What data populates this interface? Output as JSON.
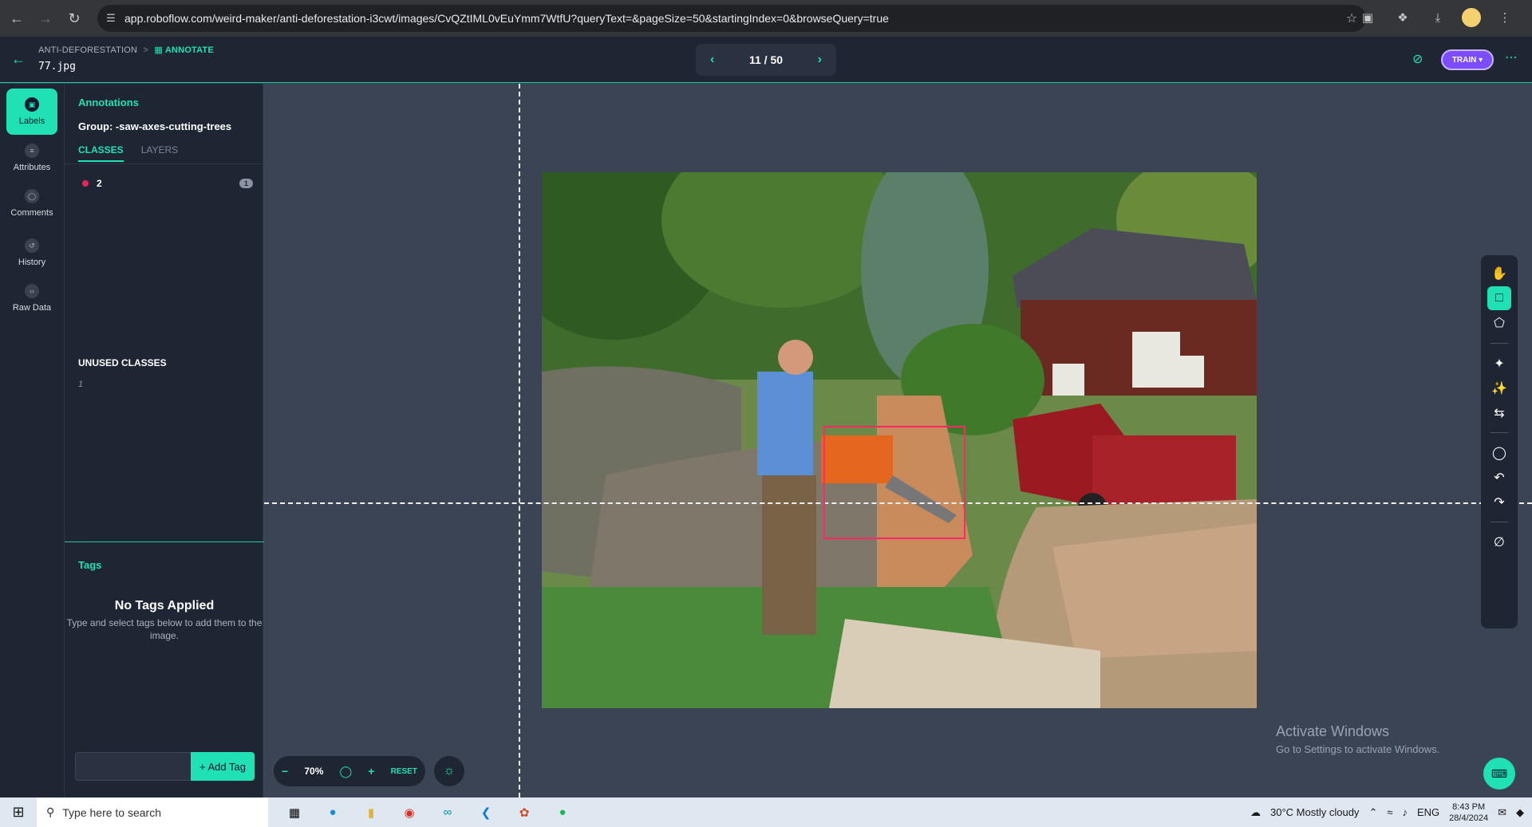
{
  "browser": {
    "url": "app.roboflow.com/weird-maker/anti-deforestation-i3cwt/images/CvQZtIML0vEuYmm7WtfU?queryText=&pageSize=50&startingIndex=0&browseQuery=true"
  },
  "header": {
    "breadcrumb_project": "ANTI-DEFORESTATION",
    "breadcrumb_separator": ">",
    "breadcrumb_current": "ANNOTATE",
    "filename": "77.jpg",
    "pager": "11 / 50",
    "train_label": "TRAIN"
  },
  "rail": {
    "items": [
      {
        "label": "Labels"
      },
      {
        "label": "Attributes"
      },
      {
        "label": "Comments"
      },
      {
        "label": "History"
      },
      {
        "label": "Raw Data"
      }
    ]
  },
  "panel": {
    "title": "Annotations",
    "group": "Group: -saw-axes-cutting-trees",
    "tabs": [
      {
        "label": "CLASSES"
      },
      {
        "label": "LAYERS"
      }
    ],
    "classes": [
      {
        "name": "2",
        "count": "1",
        "color": "#e8245d"
      }
    ],
    "unused_title": "UNUSED CLASSES",
    "unused": [
      {
        "name": "1"
      }
    ],
    "tags_title": "Tags",
    "no_tags_title": "No Tags Applied",
    "no_tags_desc": "Type and select tags below to add them to the image.",
    "add_tag_label": "+ Add Tag"
  },
  "canvas": {
    "zoom": "70%",
    "reset_label": "RESET",
    "activate_title": "Activate Windows",
    "activate_desc": "Go to Settings to activate Windows."
  },
  "taskbar": {
    "search_placeholder": "Type here to search",
    "weather": "30°C  Mostly cloudy",
    "lang": "ENG",
    "time": "8:43 PM",
    "date": "28/4/2024"
  },
  "colors": {
    "accent": "#20e0b5",
    "panel": "#1f2633",
    "canvas": "#3b4454",
    "bbox": "#ff2a63",
    "train": "#7c4dff"
  }
}
